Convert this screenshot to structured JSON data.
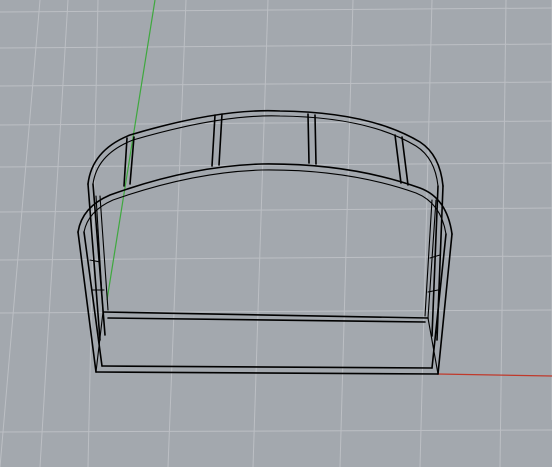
{
  "viewport": {
    "background_color": "#a3a8ae",
    "grid_line_color": "#bcbfc4",
    "x_axis_color": "#c0392b",
    "y_axis_color": "#3fa83f",
    "object_wire_color": "#000000"
  },
  "scene": {
    "object": "curved-frame-wireframe",
    "axes_visible": [
      "x",
      "y"
    ],
    "grid_visible": true
  }
}
